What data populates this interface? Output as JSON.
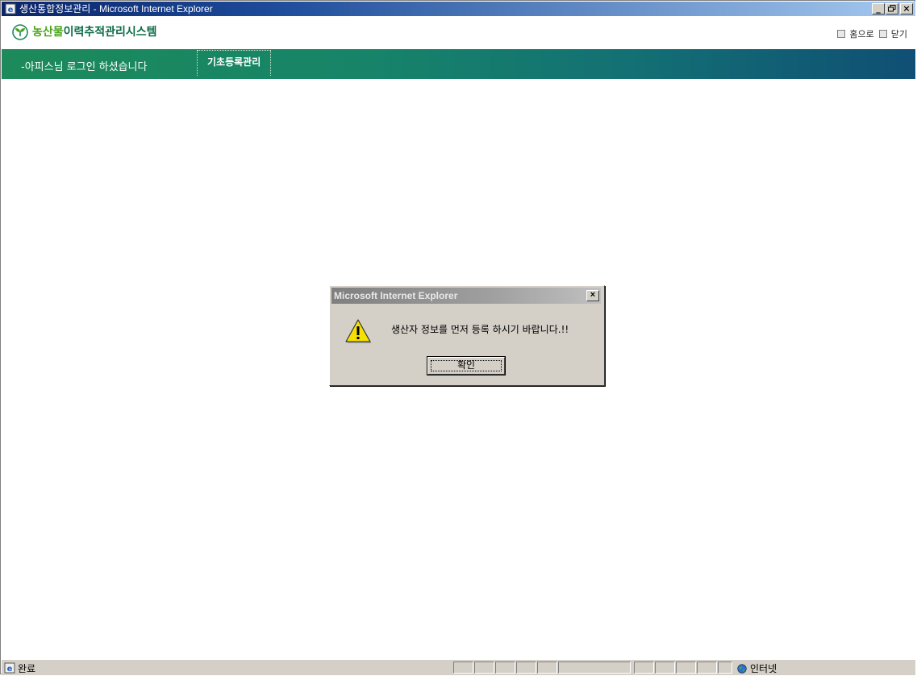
{
  "window": {
    "title": "생산통합정보관리 - Microsoft Internet Explorer",
    "buttons": {
      "minimize": "_",
      "maximize": "▫",
      "close": "×"
    }
  },
  "header": {
    "logo_part1": "농산물",
    "logo_part2": "이력추적관리시스템",
    "home_link": "홈으로",
    "close_link": "닫기"
  },
  "nav": {
    "login_message": "-아피스님 로그인 하셨습니다",
    "tab": "기초등록관리"
  },
  "dialog": {
    "title": "Microsoft Internet Explorer",
    "message": "생산자 정보를 먼저 등록 하시기 바랍니다.!!",
    "ok_label": "확인",
    "close_glyph": "×"
  },
  "statusbar": {
    "status": "완료",
    "zone": "인터넷"
  },
  "colors": {
    "titlebar": "#0a246a",
    "nav_green": "#1c8a5a",
    "nav_blue": "#0f4f74",
    "logo_green": "#4aa51e",
    "logo_dark": "#0c6b45",
    "dialog_face": "#d4d0c8"
  },
  "icons": {
    "app": "ie-page-icon",
    "logo": "sprout-circle-icon",
    "warning": "warning-triangle-icon",
    "zone": "globe-icon",
    "home": "home-icon",
    "close_small": "close-box-icon"
  }
}
